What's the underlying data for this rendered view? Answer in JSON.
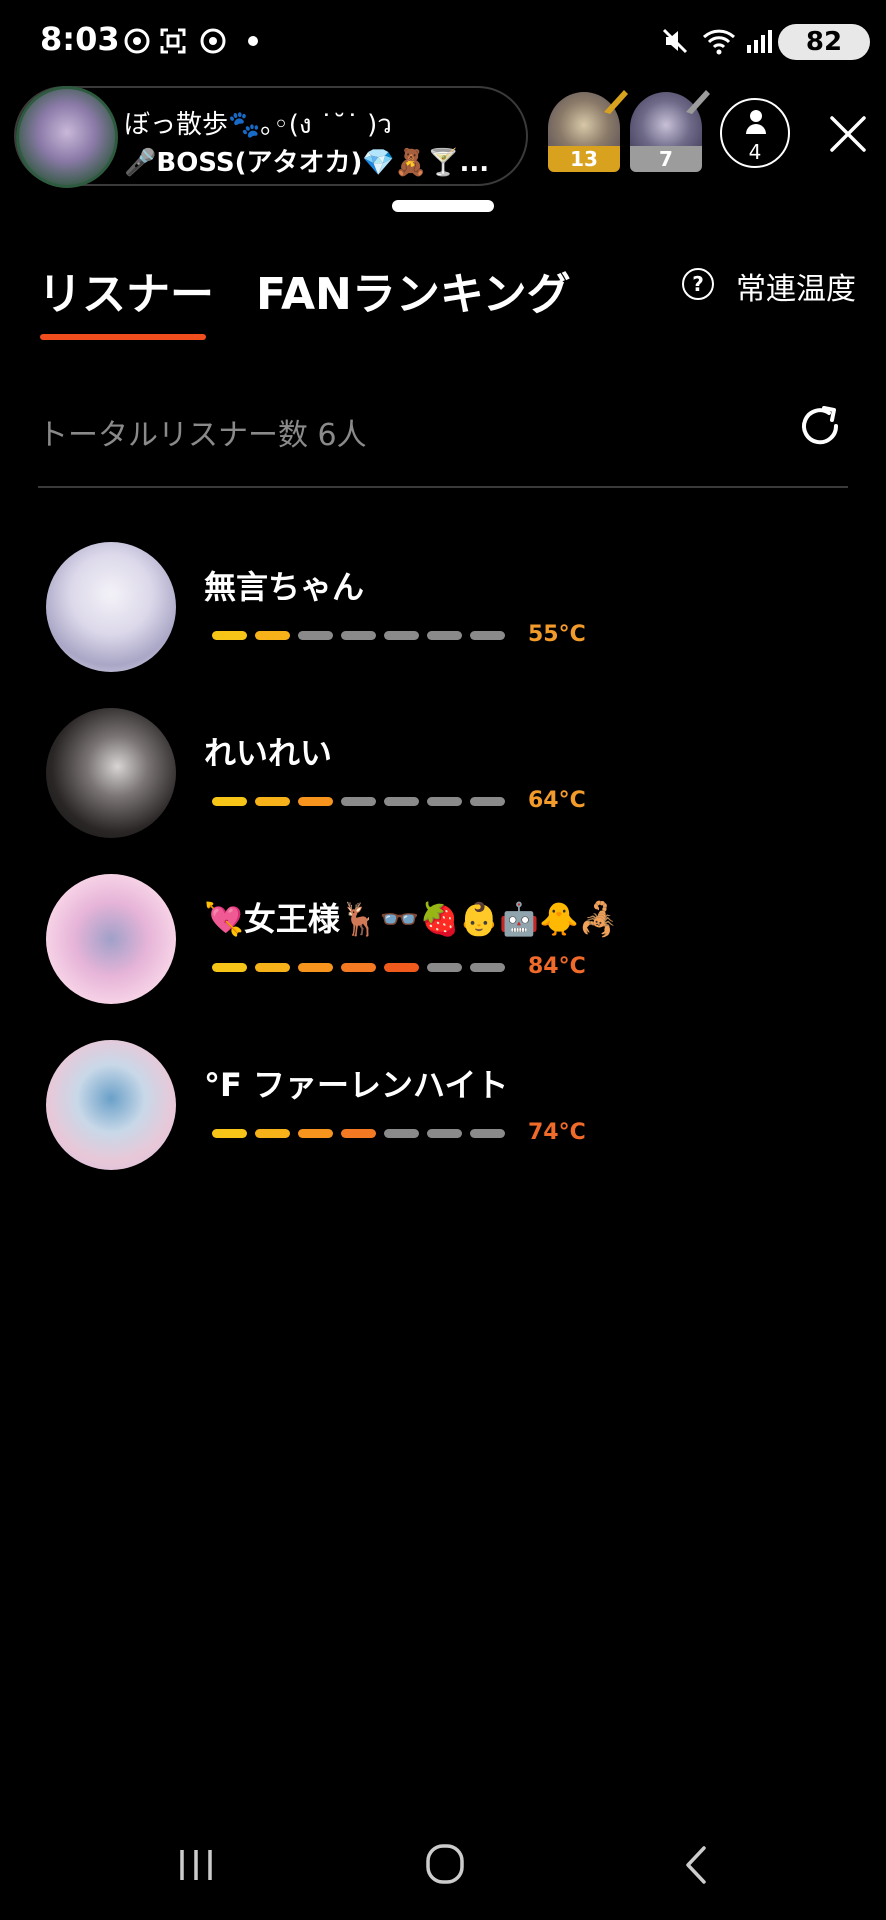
{
  "status_bar": {
    "time": "8:03",
    "battery": "82",
    "icons": [
      "chrome-icon",
      "screenshot-icon",
      "chrome-icon",
      "dot-icon",
      "mute-icon",
      "wifi-icon",
      "signal-icon"
    ]
  },
  "live_header": {
    "title": "ぼっ散歩🐾｡◦(ง ˙˘˙ )ว",
    "subtitle": "🎤BOSS(アタオカ)💎🧸🍸...",
    "badges": [
      {
        "count": "13",
        "color": "#d9a21e"
      },
      {
        "count": "7",
        "color": "#9c9c9c"
      }
    ],
    "listener_count": "4"
  },
  "tabs": {
    "listeners": "リスナー",
    "fan_ranking": "FANランキング",
    "regular_temp": "常連温度",
    "help": "?"
  },
  "summary": {
    "total_listeners": "トータルリスナー数 6人"
  },
  "listeners": [
    {
      "name": "無言ちゃん",
      "temp": "55°C",
      "level": 2,
      "temp_color": "#f29a2a"
    },
    {
      "name": "れいれい",
      "temp": "64°C",
      "level": 3,
      "temp_color": "#f29a2a"
    },
    {
      "name": "💘女王様🦌👓🍓👶🤖🐥🦂",
      "temp": "84°C",
      "level": 5,
      "temp_color": "#f06a2a"
    },
    {
      "name": "°F ファーレンハイト",
      "temp": "74°C",
      "level": 4,
      "temp_color": "#f06a2a"
    }
  ],
  "colors": {
    "accent": "#f04e1c",
    "bar_segments": [
      "#f7c518",
      "#f7b21a",
      "#f7941e",
      "#f37a22",
      "#f05a1c"
    ],
    "bar_empty": "#8a8a8a"
  }
}
